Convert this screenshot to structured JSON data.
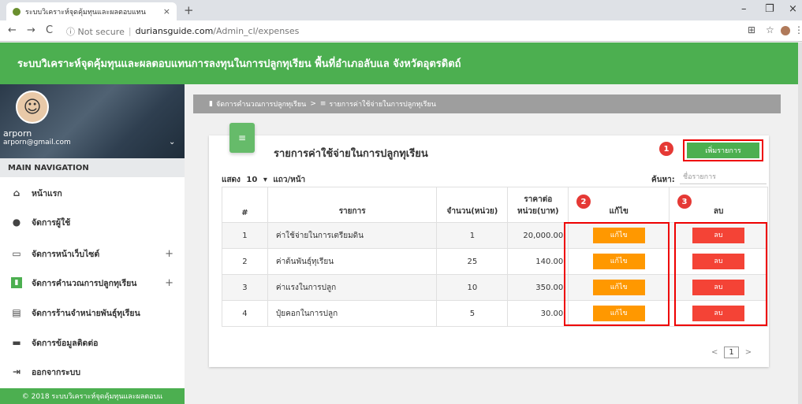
{
  "browser": {
    "tab_title": "ระบบวิเคราะห์จุดคุ้มทุนและผลตอบแทน",
    "tab_close": "×",
    "new_tab": "+",
    "url_security": "ⓘ Not secure",
    "url_host": "duriansguide.com",
    "url_path": "/Admin_cl/expenses",
    "minimize": "–",
    "maximize": "❐",
    "close": "×"
  },
  "header": {
    "title": "ระบบวิเคราะห์จุดคุ้มทุนและผลตอบแทนการลงทุนในการปลูกทุเรียน พื้นที่อำเภอลับแล จังหวัดอุตรดิตถ์"
  },
  "user": {
    "name": "arporn",
    "email": "arporn@gmail.com"
  },
  "sidebar": {
    "section_label": "MAIN NAVIGATION",
    "items": [
      {
        "label": "หน้าแรก",
        "icon": "home-icon"
      },
      {
        "label": "จัดการผู้ใช้",
        "icon": "user-icon"
      },
      {
        "label": "จัดการหน้าเว็บไซต์",
        "icon": "window-icon",
        "expandable": true
      },
      {
        "label": "จัดการคำนวณการปลูกทุเรียน",
        "icon": "chart-icon",
        "expandable": true
      },
      {
        "label": "จัดการร้านจำหน่ายพันธุ์ทุเรียน",
        "icon": "store-icon"
      },
      {
        "label": "จัดการข้อมูลติดต่อ",
        "icon": "chat-icon"
      },
      {
        "label": "ออกจากระบบ",
        "icon": "logout-icon"
      }
    ],
    "footer": "© 2018 ระบบวิเคราะห์จุดคุ้มทุนและผลตอบแ"
  },
  "breadcrumb": {
    "parent": "จัดการคำนวณการปลูกทุเรียน",
    "separator": ">",
    "current": "รายการค่าใช้จ่ายในการปลูกทุเรียน"
  },
  "card": {
    "title": "รายการค่าใช้จ่ายในการปลูกทุเรียน",
    "add_button": "เพิ่มรายการ",
    "show_label": "แสดง",
    "page_size": "10",
    "per_page_label": "แถว/หน้า",
    "search_label": "ค้นหา:",
    "search_placeholder": "ชื่อรายการ"
  },
  "table": {
    "headers": [
      "#",
      "รายการ",
      "จำนวน(หน่วย)",
      "ราคาต่อ หน่วย(บาท)",
      "แก้ไข",
      "ลบ"
    ],
    "rows": [
      {
        "no": "1",
        "item": "ค่าใช้จ่ายในการเตรียมดิน",
        "qty": "1",
        "price": "20,000.00",
        "edit": "แก้ไข",
        "delete": "ลบ"
      },
      {
        "no": "2",
        "item": "ค่าต้นพันธุ์ทุเรียน",
        "qty": "25",
        "price": "140.00",
        "edit": "แก้ไข",
        "delete": "ลบ"
      },
      {
        "no": "3",
        "item": "ค่าแรงในการปลูก",
        "qty": "10",
        "price": "350.00",
        "edit": "แก้ไข",
        "delete": "ลบ"
      },
      {
        "no": "4",
        "item": "ปุ๋ยคอกในการปลูก",
        "qty": "5",
        "price": "30.00",
        "edit": "แก้ไข",
        "delete": "ลบ"
      }
    ]
  },
  "pagination": {
    "prev": "<",
    "page": "1",
    "next": ">"
  },
  "annotations": {
    "badge1": "1",
    "badge2": "2",
    "badge3": "3"
  },
  "colors": {
    "header_green": "#4caf50",
    "edit_orange": "#ff9800",
    "delete_red": "#f44336",
    "annotation_red": "#e00"
  }
}
